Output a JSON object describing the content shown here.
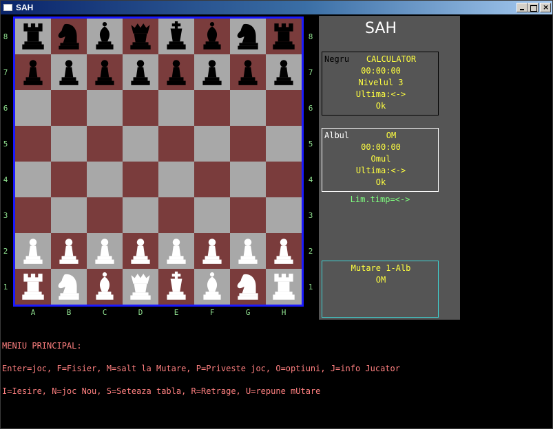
{
  "window": {
    "title": "SAH"
  },
  "app_title": "SAH",
  "board": {
    "files": [
      "A",
      "B",
      "C",
      "D",
      "E",
      "F",
      "G",
      "H"
    ],
    "ranks": [
      "8",
      "7",
      "6",
      "5",
      "4",
      "3",
      "2",
      "1"
    ],
    "pieces": [
      [
        "bR",
        "bN",
        "bB",
        "bQ",
        "bK",
        "bB",
        "bN",
        "bR"
      ],
      [
        "bP",
        "bP",
        "bP",
        "bP",
        "bP",
        "bP",
        "bP",
        "bP"
      ],
      [
        "",
        "",
        "",
        "",
        "",
        "",
        "",
        ""
      ],
      [
        "",
        "",
        "",
        "",
        "",
        "",
        "",
        ""
      ],
      [
        "",
        "",
        "",
        "",
        "",
        "",
        "",
        ""
      ],
      [
        "",
        "",
        "",
        "",
        "",
        "",
        "",
        ""
      ],
      [
        "wP",
        "wP",
        "wP",
        "wP",
        "wP",
        "wP",
        "wP",
        "wP"
      ],
      [
        "wR",
        "wN",
        "wB",
        "wQ",
        "wK",
        "wB",
        "wN",
        "wR"
      ]
    ],
    "colors": {
      "light": "#a8a8a8",
      "dark": "#7a3c3c",
      "border": "#1a1aff"
    }
  },
  "black_player": {
    "label": "Negru",
    "name": "CALCULATOR",
    "time": "00:00:00",
    "level": "Nivelul 3",
    "last": "Ultima:<->",
    "status": "Ok"
  },
  "white_player": {
    "label": "Albul",
    "name": "OM",
    "time": "00:00:00",
    "level": "Omul",
    "last": "Ultima:<->",
    "status": "Ok"
  },
  "time_limit": "Lim.timp=<->",
  "move_box": {
    "line1": "Mutare 1-Alb",
    "line2": "OM"
  },
  "menu": {
    "title": "MENIU PRINCIPAL:",
    "line1": "Enter=joc, F=Fisier, M=salt la Mutare, P=Priveste joc, O=optiuni, J=info Jucator",
    "line2": "I=Iesire, N=joc Nou, S=Seteaza tabla, R=Retrage, U=repune mUtare"
  }
}
